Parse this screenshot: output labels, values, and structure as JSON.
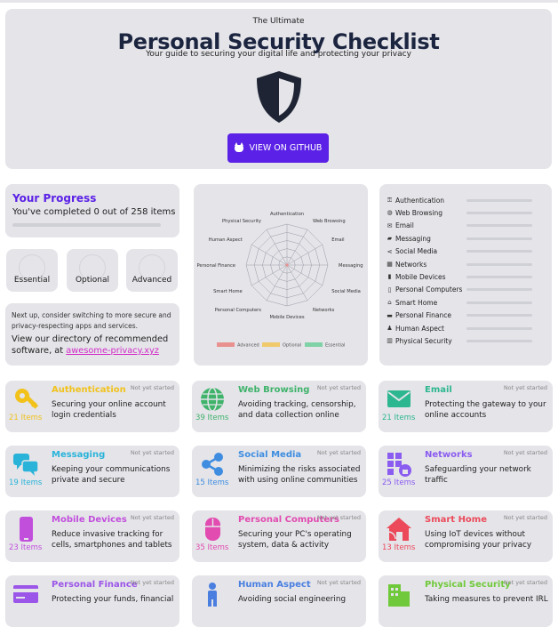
{
  "hero": {
    "kicker": "The Ultimate",
    "title": "Personal Security Checklist",
    "subtitle": "Your guide to securing your digital life and protecting your privacy",
    "button_label": "VIEW ON GITHUB"
  },
  "progress": {
    "title": "Your Progress",
    "text": "You've completed 0 out of 258 items",
    "fraction": 0
  },
  "levels": [
    "Essential",
    "Optional",
    "Advanced"
  ],
  "next_up": {
    "line1": "Next up, consider switching to more secure and privacy-respecting apps and services.",
    "line2": "View our directory of recommended software, at",
    "link": "awesome-privacy.xyz"
  },
  "radar": {
    "axes": [
      "Authentication",
      "Web Browsing",
      "Email",
      "Messaging",
      "Social Media",
      "Networks",
      "Mobile Devices",
      "Personal Computers",
      "Smart Home",
      "Personal Finance",
      "Human Aspect",
      "Physical Security"
    ],
    "legend": [
      {
        "label": "Advanced",
        "color": "#e8918f"
      },
      {
        "label": "Optional",
        "color": "#f0c96a"
      },
      {
        "label": "Essential",
        "color": "#7fd1a6"
      }
    ]
  },
  "category_list": [
    {
      "icon": "key-icon",
      "name": "Authentication"
    },
    {
      "icon": "globe-icon",
      "name": "Web Browsing"
    },
    {
      "icon": "envelope-icon",
      "name": "Email"
    },
    {
      "icon": "chat-icon",
      "name": "Messaging"
    },
    {
      "icon": "share-icon",
      "name": "Social Media"
    },
    {
      "icon": "network-icon",
      "name": "Networks"
    },
    {
      "icon": "phone-icon",
      "name": "Mobile Devices"
    },
    {
      "icon": "mouse-icon",
      "name": "Personal Computers"
    },
    {
      "icon": "home-icon",
      "name": "Smart Home"
    },
    {
      "icon": "card-icon",
      "name": "Personal Finance"
    },
    {
      "icon": "person-icon",
      "name": "Human Aspect"
    },
    {
      "icon": "building-icon",
      "name": "Physical Security"
    }
  ],
  "cards": [
    {
      "title": "Authentication",
      "items": "21 Items",
      "status": "Not yet started",
      "desc": "Securing your online account login credentials",
      "color": "#f2c21b",
      "icon": "key-icon"
    },
    {
      "title": "Web Browsing",
      "items": "39 Items",
      "status": "Not yet started",
      "desc": "Avoiding tracking, censorship, and data collection online",
      "color": "#3fb36a",
      "icon": "globe-icon"
    },
    {
      "title": "Email",
      "items": "21 Items",
      "status": "Not yet started",
      "desc": "Protecting the gateway to your online accounts",
      "color": "#2db790",
      "icon": "envelope-icon"
    },
    {
      "title": "Messaging",
      "items": "19 Items",
      "status": "Not yet started",
      "desc": "Keeping your communications private and secure",
      "color": "#29b3d9",
      "icon": "chat-icon"
    },
    {
      "title": "Social Media",
      "items": "15 Items",
      "status": "Not yet started",
      "desc": "Minimizing the risks associated with using online communities",
      "color": "#3e8de0",
      "icon": "share-icon"
    },
    {
      "title": "Networks",
      "items": "25 Items",
      "status": "Not yet started",
      "desc": "Safeguarding your network traffic",
      "color": "#8b5cf0",
      "icon": "network-icon"
    },
    {
      "title": "Mobile Devices",
      "items": "23 Items",
      "status": "Not yet started",
      "desc": "Reduce invasive tracking for cells, smartphones and tablets",
      "color": "#c24fdc",
      "icon": "phone-icon"
    },
    {
      "title": "Personal Computers",
      "items": "35 Items",
      "status": "Not yet started",
      "desc": "Securing your PC's operating system, data & activity",
      "color": "#e24bb0",
      "icon": "mouse-icon"
    },
    {
      "title": "Smart Home",
      "items": "13 Items",
      "status": "Not yet started",
      "desc": "Using IoT devices without compromising your privacy",
      "color": "#ec4a5a",
      "icon": "home-icon"
    },
    {
      "title": "Personal Finance",
      "items": "",
      "status": "Not yet started",
      "desc": "Protecting your funds, financial",
      "color": "#9b55e8",
      "icon": "card-icon"
    },
    {
      "title": "Human Aspect",
      "items": "",
      "status": "Not yet started",
      "desc": "Avoiding social engineering",
      "color": "#4a7fe0",
      "icon": "person-icon"
    },
    {
      "title": "Physical Security",
      "items": "",
      "status": "Not yet started",
      "desc": "Taking measures to prevent IRL",
      "color": "#70c93a",
      "icon": "building-icon"
    }
  ]
}
